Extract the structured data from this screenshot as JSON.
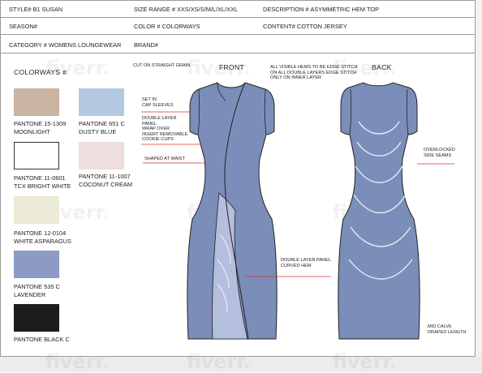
{
  "header": {
    "style": "STYLE#   B1  SUSAN",
    "size_range": "SIZE RANGE #  XXS/XS/S/M/L/XL/XXL",
    "description": "DESCRIPTION #    ASYMMETRIC HEM TOP",
    "season": "SEASON#",
    "color": "COLOR #  COLORWAYS",
    "content": "CONTENT#  COTTON JERSEY",
    "category": "CATEGORY # WOMENS LOUNGEWEAR",
    "brand": "BRAND#"
  },
  "colorways": {
    "title": "COLORWAYS #",
    "swatches": [
      {
        "line1": "PANTONE 15-1309",
        "line2": "MOONLIGHT",
        "color": "#c8b4a0"
      },
      {
        "line1": "PANTONE 651 C",
        "line2": "DUSTY BLUE",
        "color": "#b3c9e2"
      },
      {
        "line1": "PANTONE 11-0601",
        "line2": "TCX BRIGHT WHITE",
        "color": "#ffffff"
      },
      {
        "line1": "PANTONE 11-1007",
        "line2": "COCONUT CREAM",
        "color": "#eedede"
      },
      {
        "line1": "PANTONE 12-0104",
        "line2": "WHITE ASPARAGUS",
        "color": "#ecebd6"
      },
      {
        "line1": "PANTONE 535 C",
        "line2": "LAVENDER",
        "color": "#8b9bc4"
      },
      {
        "line1": "PANTONE BLACK C",
        "line2": "",
        "color": "#1c1c1c"
      }
    ]
  },
  "views": {
    "front": "FRONT",
    "back": "BACK"
  },
  "annotations": {
    "cut": "CUT ON STRAIGHT GRAIN",
    "hems": [
      "ALL VISIBLE HEMS TO BE EDGE STITCH",
      "ON ALL DOUBLE LAYERS EDGE STITCH",
      "ONLY ON INNER LAYER"
    ],
    "set_in": [
      "SET IN",
      "CAP SLEEVES"
    ],
    "double_layer": [
      "DOUBLE LAYER",
      "PANEL",
      "WRAP OVER",
      "INSERT REMOVABLE",
      "COOKIE CUPS"
    ],
    "shaped": "SHAPED AT WAIST",
    "panel": [
      "DOUBLE LAYER PANEL",
      "CURVED HEM"
    ],
    "overlocked": [
      "OVERLOCKED",
      "SIDE SEAMS"
    ],
    "mid_calve": [
      "MID CALVE",
      "DRAPED LENGTH"
    ]
  },
  "watermark": "fiverr.",
  "garment_color": "#7b8db9",
  "panel_color": "#b4bedd"
}
